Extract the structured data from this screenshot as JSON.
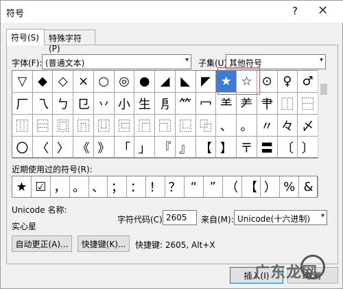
{
  "window": {
    "title": "符号",
    "help": "?",
    "close": "✕"
  },
  "tabs": [
    {
      "label": "符号(S)"
    },
    {
      "label": "特殊字符(P)"
    }
  ],
  "font": {
    "label": "字体(F):",
    "value": "(普通文本)"
  },
  "subset": {
    "label": "子集(U):",
    "value": "其他符号"
  },
  "grid": [
    [
      "▽",
      "◆",
      "◇",
      "×",
      "○",
      "◎",
      "●",
      "◢",
      "◣",
      "◤",
      "★",
      "☆",
      "⊙",
      "♀",
      "♂"
    ],
    [
      "厂",
      "乁",
      "ㄅ",
      "㔾",
      "丷",
      "小",
      "生",
      "㐆",
      "⺮",
      "冖",
      "⺷",
      "⺶",
      "⺺",
      "⿰",
      "⿱"
    ],
    [
      "⿲",
      "⿳",
      "⿴",
      "⿵",
      "⿶",
      "⿷",
      "⿸",
      "⿹",
      "⿺",
      "⿻",
      "、",
      "。",
      "〃",
      "々",
      "〆"
    ],
    [
      "〇",
      "〈",
      "〉",
      "《",
      "》",
      "「",
      "」",
      "『",
      "』",
      "【",
      "】",
      "〒",
      "〓",
      "〔",
      "〕"
    ]
  ],
  "selected_symbol": "★",
  "recent_label": "近期使用过的符号(R):",
  "recent": [
    "★",
    "☑",
    "，",
    "。",
    "、",
    "；",
    "：",
    "！",
    "？",
    "“",
    "”",
    "（",
    "【",
    "）",
    "%",
    "&"
  ],
  "unicode_name_label": "Unicode 名称:",
  "unicode_name": "实心星",
  "char_code_label": "字符代码(C):",
  "char_code": "2605",
  "from_label": "来自(M):",
  "from_value": "Unicode(十六进制)",
  "autocorrect_button": "自动更正(A)...",
  "shortcut_button": "快捷键(K)...",
  "shortcut_text": "快捷键: 2605, Alt+X",
  "insert_button": "插入(I)",
  "cancel_button": "取消",
  "watermark": "广东龙网"
}
